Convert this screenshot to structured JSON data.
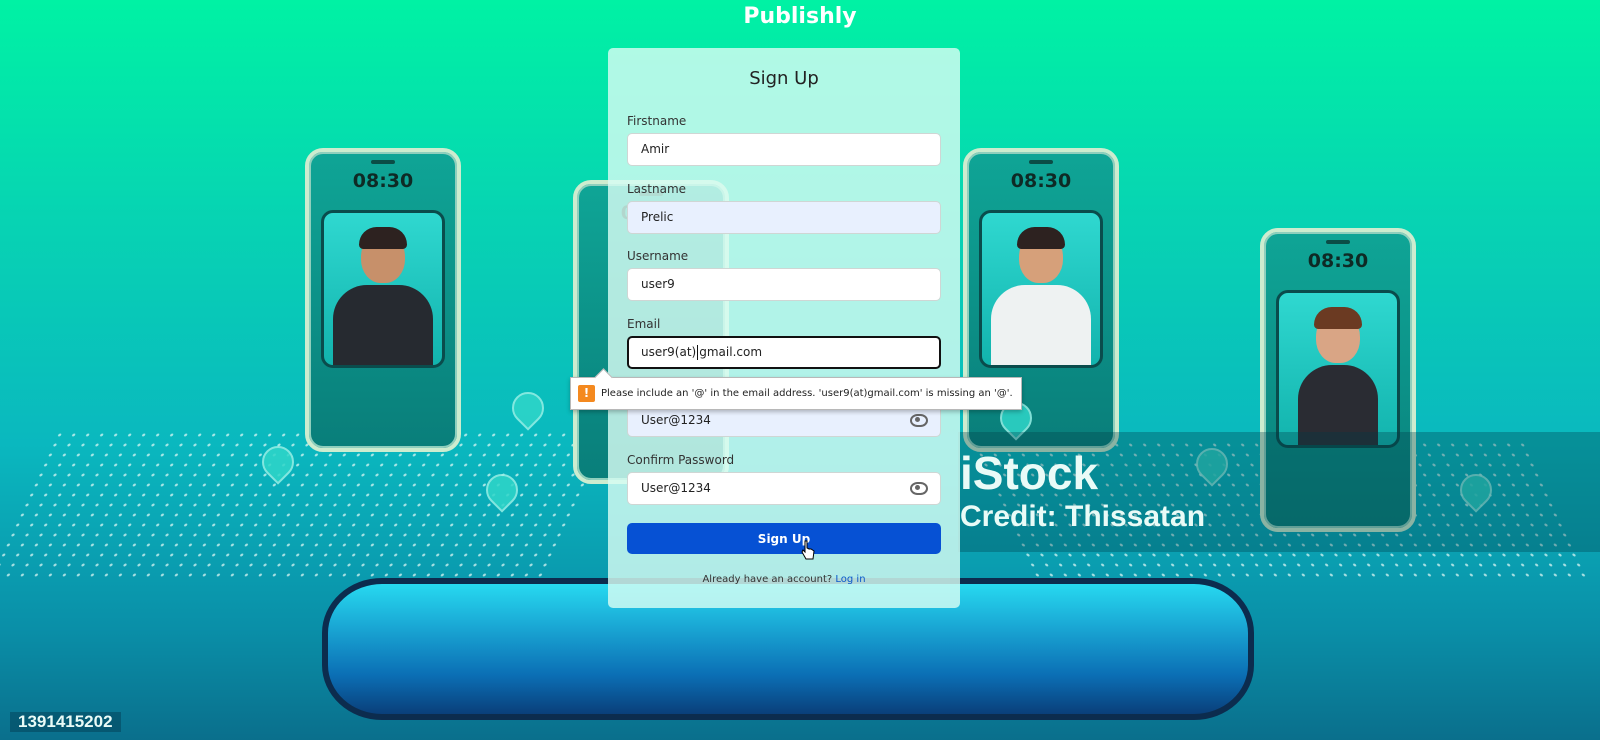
{
  "app": {
    "title": "Publishly"
  },
  "form": {
    "heading": "Sign Up",
    "fields": {
      "firstname": {
        "label": "Firstname",
        "value": "Amir"
      },
      "lastname": {
        "label": "Lastname",
        "value": "Prelic"
      },
      "username": {
        "label": "Username",
        "value": "user9"
      },
      "email": {
        "label": "Email",
        "value_before_caret": "user9(at)",
        "value_after_caret": "gmail.com"
      },
      "password": {
        "value": "User@1234"
      },
      "confirm_password": {
        "label": "Confirm Password",
        "value": "User@1234"
      }
    },
    "validation_tooltip": "Please include an '@' in the email address. 'user9(at)gmail.com' is missing an '@'.",
    "submit_label": "Sign Up",
    "footer_text": "Already have an account?",
    "login_link": "Log in"
  },
  "background": {
    "phone_time": "08:30",
    "watermark_brand": "iStock",
    "watermark_credit": "Credit: Thissatan",
    "image_id": "1391415202"
  },
  "colors": {
    "accent": "#0651d4",
    "warning": "#f4891f"
  }
}
